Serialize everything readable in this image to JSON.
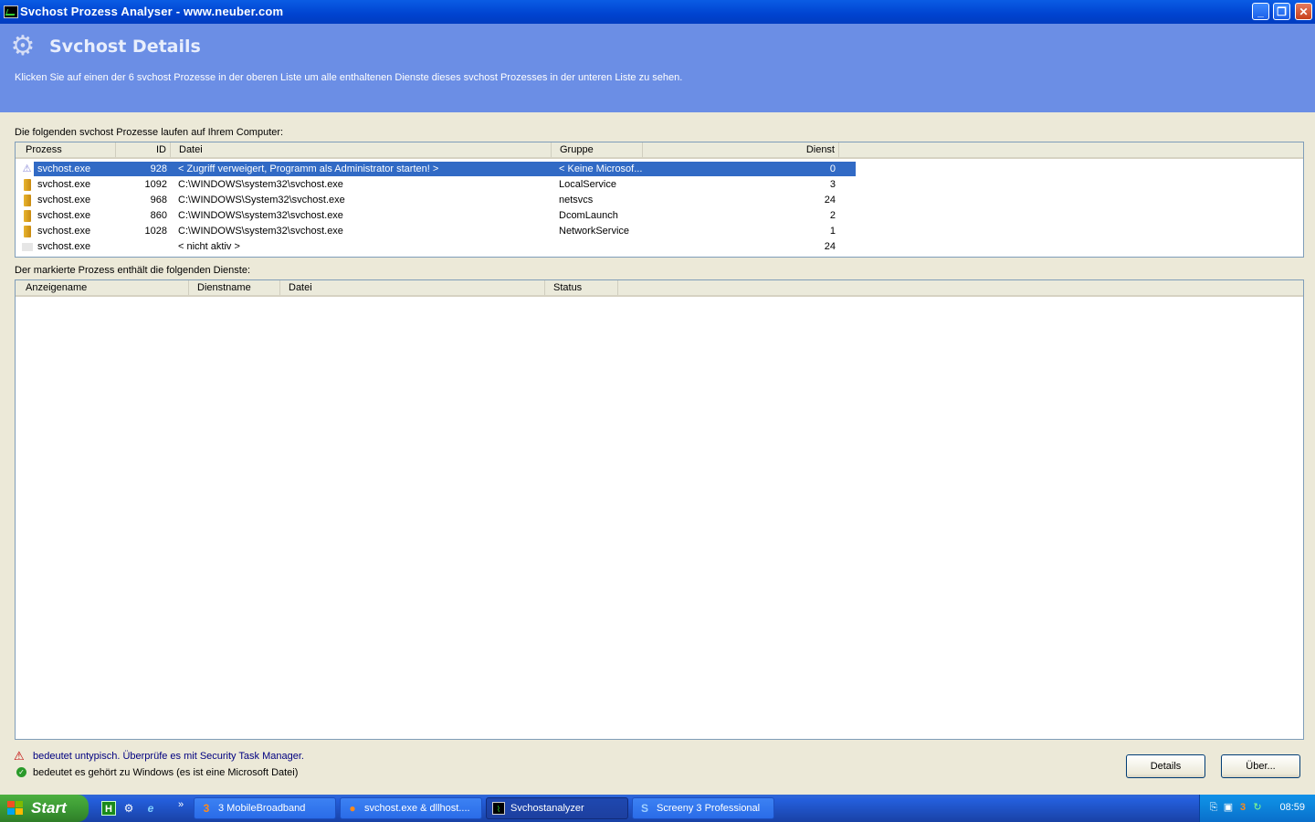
{
  "window": {
    "title": "Svchost Prozess Analyser - www.neuber.com",
    "min_icon": "minimize-icon",
    "max_icon": "restore-icon",
    "close_icon": "close-icon"
  },
  "header": {
    "title": "Svchost Details",
    "description": "Klicken Sie auf einen der 6 svchost Prozesse in der oberen Liste um alle enthaltenen Dienste dieses svchost Prozesses in der unteren Liste zu sehen.",
    "background_color": "#6b8ee5"
  },
  "process_list": {
    "label": "Die folgenden svchost Prozesse laufen auf Ihrem Computer:",
    "columns": [
      "Prozess",
      "ID",
      "Datei",
      "Gruppe",
      "Dienst"
    ],
    "rows": [
      {
        "icon": "warning",
        "name": "svchost.exe",
        "id": "928",
        "file": "< Zugriff verweigert, Programm als Administrator starten! >",
        "group": "< Keine Microsof...",
        "services": "0",
        "selected": true
      },
      {
        "icon": "folder",
        "name": "svchost.exe",
        "id": "1092",
        "file": "C:\\WINDOWS\\system32\\svchost.exe",
        "group": "LocalService",
        "services": "3"
      },
      {
        "icon": "folder",
        "name": "svchost.exe",
        "id": "968",
        "file": "C:\\WINDOWS\\System32\\svchost.exe",
        "group": "netsvcs",
        "services": "24"
      },
      {
        "icon": "folder",
        "name": "svchost.exe",
        "id": "860",
        "file": "C:\\WINDOWS\\system32\\svchost.exe",
        "group": "DcomLaunch",
        "services": "2"
      },
      {
        "icon": "folder",
        "name": "svchost.exe",
        "id": "1028",
        "file": "C:\\WINDOWS\\system32\\svchost.exe",
        "group": "NetworkService",
        "services": "1"
      },
      {
        "icon": "blank",
        "name": "svchost.exe",
        "id": "",
        "file": "< nicht aktiv >",
        "group": "",
        "services": "24"
      }
    ]
  },
  "services_list": {
    "label": "Der markierte Prozess enthält die folgenden Dienste:",
    "columns": [
      "Anzeigename",
      "Dienstname",
      "Datei",
      "Status"
    ]
  },
  "legend": {
    "warning_text": "bedeutet untypisch. Überprüfe es mit Security Task Manager.",
    "ok_text": "bedeutet es gehört zu Windows (es ist eine Microsoft Datei)"
  },
  "buttons": {
    "details": "Details",
    "about": "Über..."
  },
  "taskbar": {
    "start_label": "Start",
    "items": [
      {
        "label": "3 MobileBroadband",
        "icon": "3-logo-icon",
        "active": false
      },
      {
        "label": "svchost.exe & dllhost....",
        "icon": "firefox-icon",
        "active": false
      },
      {
        "label": "Svchostanalyzer",
        "icon": "monitor-icon",
        "active": true
      },
      {
        "label": "Screeny 3 Professional",
        "icon": "screeny-icon",
        "active": false
      }
    ],
    "overflow": "»",
    "clock": "08:59"
  }
}
